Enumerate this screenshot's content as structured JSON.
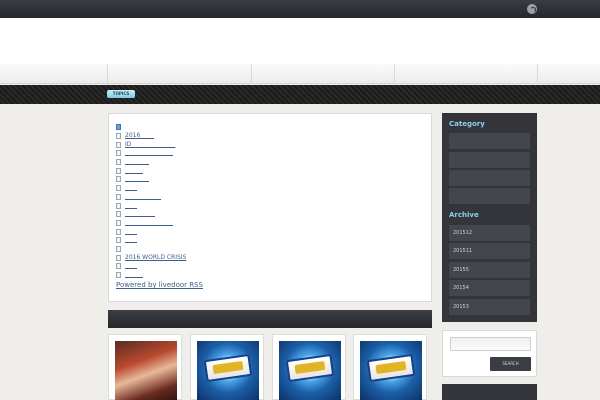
{
  "header": {
    "topics_label": "TOPICS"
  },
  "main": {
    "items": [
      {
        "label": "",
        "icon": "checkbox-icon"
      },
      {
        "label": "2016 　　"
      },
      {
        "label": "ID 　　　　　　　"
      },
      {
        "label": "　　　　　　　　"
      },
      {
        "label": "　　　　"
      },
      {
        "label": "　　　"
      },
      {
        "label": "　　　　"
      },
      {
        "label": "　　"
      },
      {
        "label": "　　　　　　"
      },
      {
        "label": "　　"
      },
      {
        "label": "　　　　　"
      },
      {
        "label": "　　　　　　　　"
      },
      {
        "label": "　　"
      },
      {
        "label": "　　"
      },
      {
        "label": ""
      },
      {
        "label": "2016 WORLD CRISIS"
      },
      {
        "label": "　　"
      },
      {
        "label": "　　　"
      }
    ],
    "powered_label": "Powered by livedoor RSS"
  },
  "sidebar": {
    "category_heading": "Category",
    "category_items": [
      "",
      "",
      "",
      ""
    ],
    "archive_heading": "Archive",
    "archive_items": [
      "201512",
      "201511",
      "20155",
      "20154",
      "20153"
    ]
  },
  "search": {
    "button_label": "SEARCH",
    "placeholder": ""
  },
  "colors": {
    "accent": "#8ed0ea",
    "dark": "#33353b",
    "link": "#3c5d8c"
  }
}
